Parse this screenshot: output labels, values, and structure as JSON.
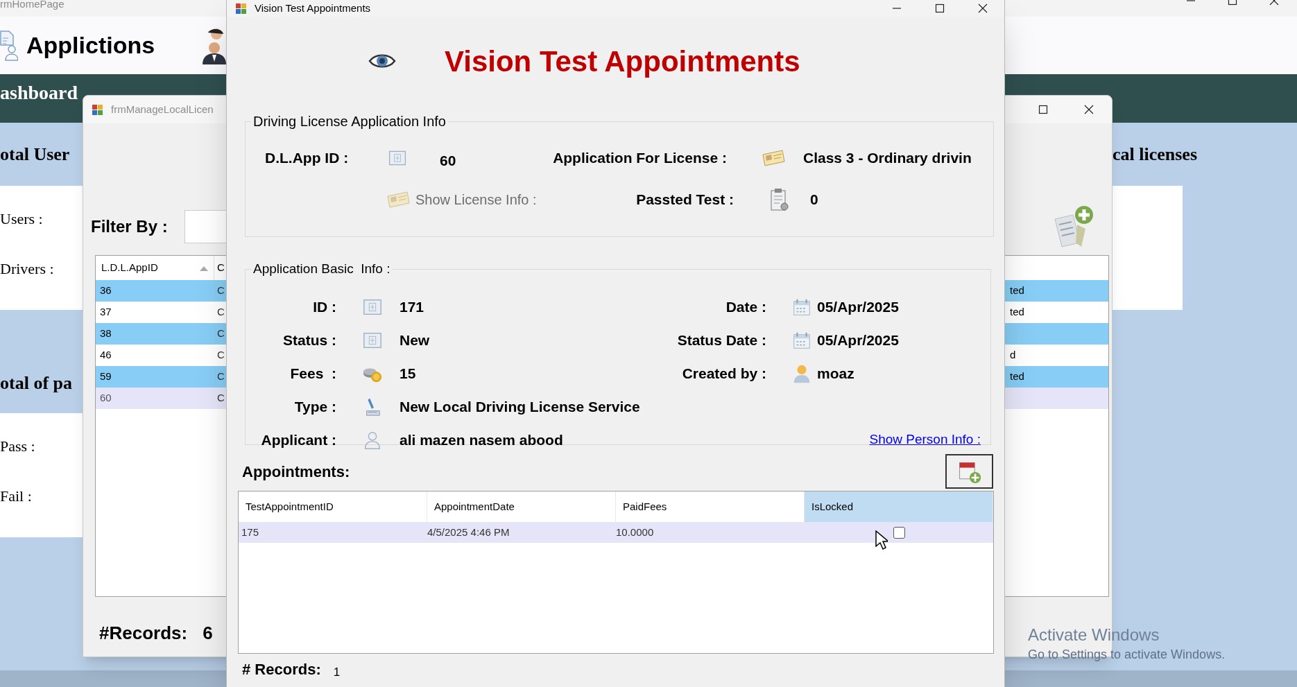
{
  "home_window": {
    "title": "rmHomePage",
    "header_title": "Applictions",
    "nav_title": "ashboard",
    "cards": [
      {
        "title": "otal User",
        "rows": [
          "Users :",
          "Drivers :"
        ]
      },
      {
        "title": "otal of pa",
        "rows": [
          "Pass :",
          "Fail :"
        ]
      }
    ],
    "right_card": {
      "title": "cal licenses"
    }
  },
  "manage_window": {
    "title": "frmManageLocalLicen",
    "filter_label": "Filter By :",
    "columns": [
      {
        "label": "L.D.L.AppID",
        "sorted_ascending": true
      },
      {
        "label": "C",
        "sorted_ascending": false
      }
    ],
    "rows": [
      {
        "id": "36",
        "column_2": "C",
        "last_column": "ted",
        "selected": true,
        "current": false
      },
      {
        "id": "37",
        "column_2": "C",
        "last_column": "ted",
        "selected": false,
        "current": false
      },
      {
        "id": "38",
        "column_2": "C",
        "selected": true,
        "current": false
      },
      {
        "id": "46",
        "column_2": "C",
        "last_column": "d",
        "selected": false,
        "current": false
      },
      {
        "id": "59",
        "column_2": "C",
        "last_column": "ted",
        "selected": true,
        "current": false
      },
      {
        "id": "60",
        "column_2": "C",
        "selected": false,
        "current": true
      }
    ],
    "records_label": "#Records:",
    "records_count": "6"
  },
  "dialog": {
    "title": "Vision Test Appointments",
    "heading": "Vision Test Appointments",
    "license_info": {
      "legend": "Driving License Application Info",
      "app_id_label": "D.L.App ID :",
      "app_id": "60",
      "license_class_label": "Application For License :",
      "license_class": "Class 3 - Ordinary drivin",
      "show_license_info": {
        "label": "Show License Info :",
        "disabled": true
      },
      "passed_tests_label": "Passted Test :",
      "passed_tests": "0"
    },
    "basic_info": {
      "legend": "Application Basic  Info :",
      "fields_left": [
        {
          "label": "ID :",
          "value": "171",
          "kind": "id"
        },
        {
          "label": "Status :",
          "value": "New",
          "kind": "id"
        },
        {
          "label": "Fees  :",
          "value": "15",
          "kind": "money"
        },
        {
          "label": "Type :",
          "value": "New Local Driving License Service",
          "kind": "document"
        },
        {
          "label": "Applicant :",
          "value": "ali mazen nasem abood",
          "kind": "person"
        }
      ],
      "fields_right": [
        {
          "label": "Date :",
          "value": "05/Apr/2025",
          "kind": "date"
        },
        {
          "label": "Status Date :",
          "value": "05/Apr/2025",
          "kind": "date"
        },
        {
          "label": "Created by :",
          "value": "moaz",
          "kind": "user"
        }
      ],
      "show_person_info": "Show Person Info :"
    },
    "appointments": {
      "title": "Appointments:",
      "columns": [
        {
          "label": "TestAppointmentID",
          "selected": false
        },
        {
          "label": "AppointmentDate",
          "selected": false
        },
        {
          "label": "PaidFees",
          "selected": false
        },
        {
          "label": "IsLocked",
          "selected": true
        }
      ],
      "rows": [
        {
          "cells": [
            "175",
            "4/5/2025 4:46 PM",
            "10.0000"
          ],
          "locked": false,
          "selected": true
        }
      ],
      "records_label": "# Records:",
      "records_count": "1"
    }
  },
  "os_notice": {
    "title": "Activate Windows",
    "subtitle": "Go to Settings to activate Windows."
  }
}
